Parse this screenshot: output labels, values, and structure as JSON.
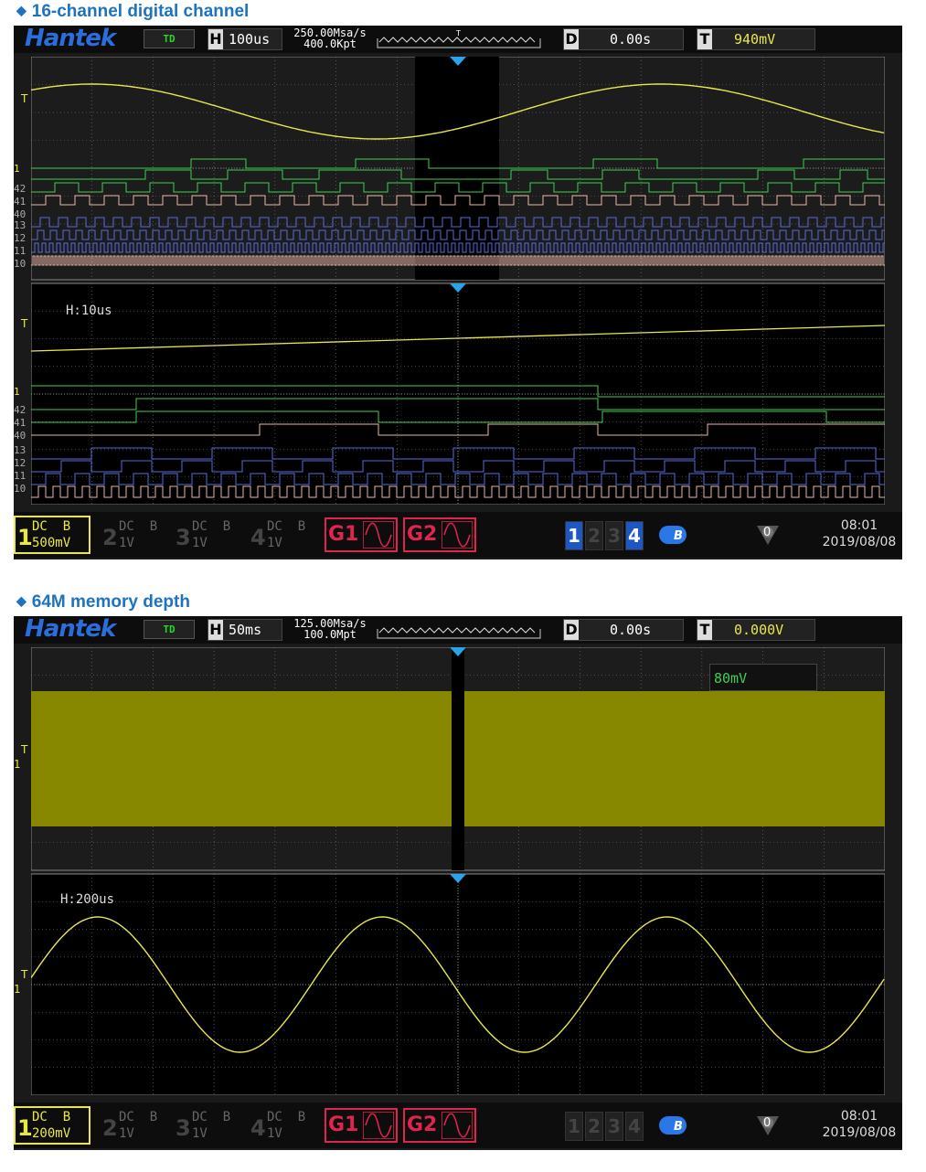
{
  "sections": [
    {
      "heading": "16-channel digital channel",
      "scope": {
        "brand": "Hantek",
        "mode_badge": "TD",
        "timebase_label": "H",
        "timebase": "100us",
        "sample_rate": "250.00Msa/s",
        "memory": "400.0Kpt",
        "delay_label": "D",
        "delay": "0.00s",
        "trigger_label": "T",
        "trigger_level": "940mV",
        "zoom_label": "H:10us",
        "marker_T": "T",
        "channel_labels_top": [
          "1",
          "42",
          "41",
          "40",
          "13",
          "12",
          "11",
          "10"
        ],
        "channel_labels_zoom": [
          "1",
          "42",
          "41",
          "40",
          "13",
          "12",
          "11",
          "10"
        ],
        "channels": [
          {
            "num": "1",
            "coupling": "DC",
            "bw": "B",
            "scale": "500mV"
          },
          {
            "num": "2",
            "coupling": "DC",
            "bw": "B",
            "scale": "1V"
          },
          {
            "num": "3",
            "coupling": "DC",
            "bw": "B",
            "scale": "1V"
          },
          {
            "num": "4",
            "coupling": "DC",
            "bw": "B",
            "scale": "1V"
          }
        ],
        "gen1": "G1",
        "gen2": "G2",
        "digital_groups": [
          "1",
          "2",
          "3",
          "4"
        ],
        "bt_badge": "B",
        "trigger_count": "0",
        "time": "08:01",
        "date": "2019/08/08"
      }
    },
    {
      "heading": "64M memory depth",
      "scope": {
        "brand": "Hantek",
        "mode_badge": "TD",
        "timebase_label": "H",
        "timebase": "50ms",
        "sample_rate": "125.00Msa/s",
        "memory": "100.0Mpt",
        "delay_label": "D",
        "delay": "0.00s",
        "trigger_label": "T",
        "trigger_level": "0.000V",
        "scale_tooltip": "80mV",
        "zoom_label": "H:200us",
        "marker_T": "T",
        "channel_label": "1",
        "channels": [
          {
            "num": "1",
            "coupling": "DC",
            "bw": "B",
            "scale": "200mV"
          },
          {
            "num": "2",
            "coupling": "DC",
            "bw": "B",
            "scale": "1V"
          },
          {
            "num": "3",
            "coupling": "DC",
            "bw": "B",
            "scale": "1V"
          },
          {
            "num": "4",
            "coupling": "DC",
            "bw": "B",
            "scale": "1V"
          }
        ],
        "gen1": "G1",
        "gen2": "G2",
        "digital_groups": [
          "1",
          "2",
          "3",
          "4"
        ],
        "bt_badge": "B",
        "trigger_count": "0",
        "time": "08:01",
        "date": "2019/08/08"
      }
    }
  ],
  "colors": {
    "ch1": "#e8e84a",
    "digital_green": "#3fcf52",
    "digital_pink": "#e8b8a8",
    "digital_blue": "#5a6cd8",
    "grid": "#7a7a7a",
    "generator": "#e0244d",
    "fill_band": "#888800"
  }
}
